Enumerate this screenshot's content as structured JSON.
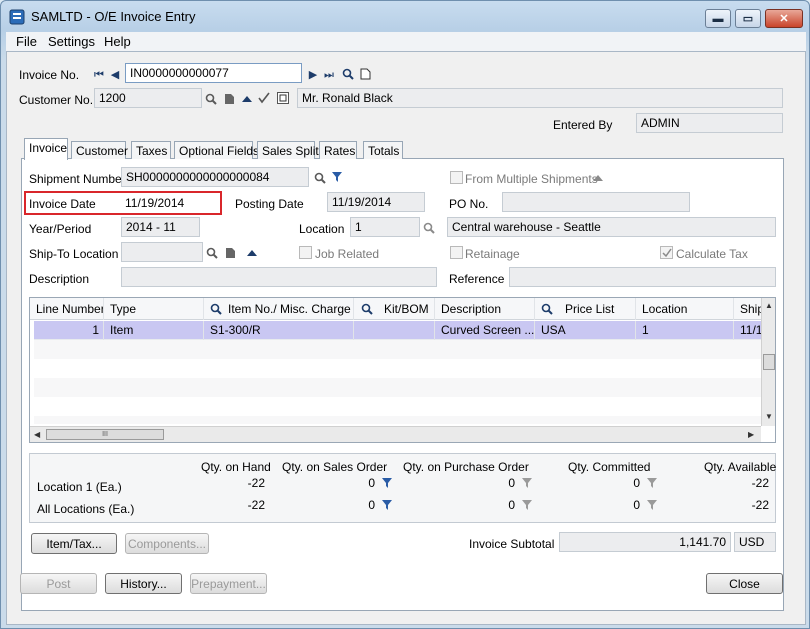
{
  "window": {
    "title": "SAMLTD - O/E Invoice Entry",
    "min": "▬",
    "max": "▭",
    "close": "✕"
  },
  "menu": {
    "file": "File",
    "settings": "Settings",
    "help": "Help"
  },
  "header": {
    "invoice_no_label": "Invoice No.",
    "invoice_no_value": "IN0000000000077",
    "customer_no_label": "Customer No.",
    "customer_no_value": "1200",
    "customer_name": "Mr. Ronald Black",
    "entered_by_label": "Entered By",
    "entered_by_value": "ADMIN"
  },
  "tabs": [
    "Invoice",
    "Customer",
    "Taxes",
    "Optional Fields",
    "Sales Split",
    "Rates",
    "Totals"
  ],
  "invoice": {
    "shipment_number_label": "Shipment Number",
    "shipment_number_value": "SH0000000000000000084",
    "from_multiple_shipments_label": "From Multiple Shipments",
    "invoice_date_label": "Invoice Date",
    "invoice_date_value": "11/19/2014",
    "posting_date_label": "Posting Date",
    "posting_date_value": "11/19/2014",
    "po_no_label": "PO No.",
    "po_no_value": "",
    "year_period_label": "Year/Period",
    "year_period_value": "2014 - 11",
    "location_label": "Location",
    "location_value": "1",
    "location_desc": "Central warehouse - Seattle",
    "ship_to_label": "Ship-To Location",
    "ship_to_value": "",
    "job_related_label": "Job Related",
    "retainage_label": "Retainage",
    "calculate_tax_label": "Calculate Tax",
    "description_label": "Description",
    "reference_label": "Reference"
  },
  "grid": {
    "columns": [
      "Line Number",
      "Type",
      "Item No./ Misc. Charge",
      "Kit/BOM",
      "Description",
      "Price List",
      "Location",
      "Ship"
    ],
    "rows": [
      {
        "line": "1",
        "type": "Item",
        "item": "S1-300/R",
        "kit": "",
        "desc": "Curved Screen ...",
        "price_list": "USA",
        "location": "1",
        "ship": "11/1"
      }
    ],
    "hscroll_grip": "III"
  },
  "quantities": {
    "headers": [
      "Qty. on Hand",
      "Qty. on Sales Order",
      "Qty. on Purchase Order",
      "Qty. Committed",
      "Qty. Available"
    ],
    "location_label": "Location  1 (Ea.)",
    "all_label": "All Locations (Ea.)",
    "location_values": [
      "-22",
      "0",
      "0",
      "0",
      "-22"
    ],
    "all_values": [
      "-22",
      "0",
      "0",
      "0",
      "-22"
    ]
  },
  "buttons": {
    "item_tax": "Item/Tax...",
    "components": "Components...",
    "post": "Post",
    "history": "History...",
    "prepayment": "Prepayment...",
    "close": "Close"
  },
  "subtotal": {
    "label": "Invoice Subtotal",
    "value": "1,141.70",
    "currency": "USD"
  },
  "colors": {
    "highlight_box": "#d9262b",
    "selected_row": "#c9c7f2"
  }
}
